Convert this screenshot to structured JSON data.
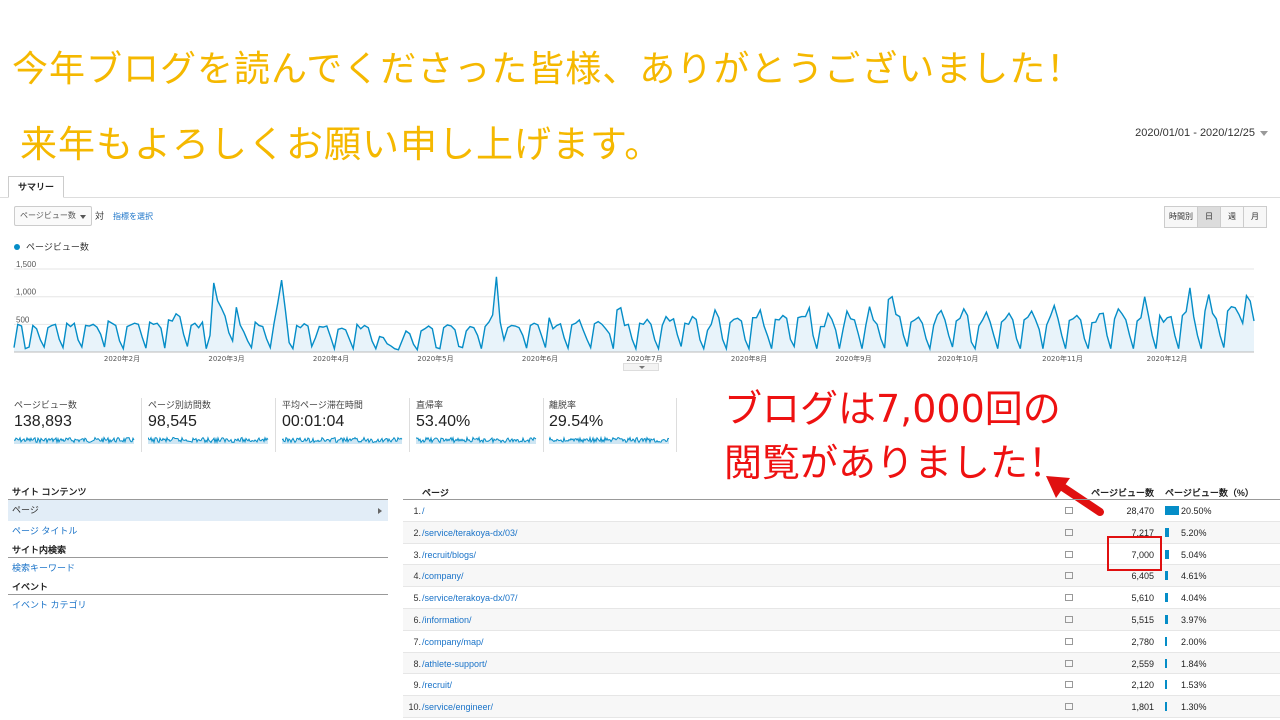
{
  "headline": {
    "line1": "今年ブログを読んでくださった皆様、ありがとうございました！",
    "line2": "来年もよろしくお願い申し上げます。"
  },
  "date_range": "2020/01/01 - 2020/12/25",
  "tabs": [
    "サマリー"
  ],
  "controls": {
    "metric_select": "ページビュー数",
    "vs_label": "対",
    "select_metric_link": "指標を選択",
    "granularity": [
      "時間別",
      "日",
      "週",
      "月"
    ],
    "granularity_selected": "日"
  },
  "chart_data": {
    "type": "line",
    "series": [
      {
        "name": "ページビュー数"
      }
    ],
    "yticks": [
      "1,500",
      "1,000",
      "500"
    ],
    "ylim": [
      0,
      1700
    ],
    "xticks": [
      "2020年2月",
      "2020年3月",
      "2020年4月",
      "2020年5月",
      "2020年6月",
      "2020年7月",
      "2020年8月",
      "2020年9月",
      "2020年10月",
      "2020年11月",
      "2020年12月"
    ],
    "values": [
      80,
      500,
      470,
      60,
      90,
      480,
      420,
      220,
      90,
      440,
      480,
      500,
      230,
      80,
      520,
      460,
      520,
      220,
      90,
      480,
      470,
      500,
      450,
      320,
      90,
      560,
      520,
      480,
      200,
      60,
      460,
      490,
      520,
      500,
      270,
      70,
      540,
      500,
      520,
      430,
      70,
      580,
      560,
      690,
      640,
      320,
      100,
      480,
      520,
      440,
      540,
      60,
      300,
      1250,
      930,
      800,
      650,
      350,
      200,
      810,
      490,
      360,
      200,
      80,
      540,
      480,
      460,
      240,
      80,
      520,
      890,
      1300,
      760,
      170,
      60,
      480,
      440,
      510,
      470,
      100,
      260,
      460,
      450,
      470,
      270,
      60,
      410,
      430,
      400,
      230,
      60,
      500,
      420,
      480,
      440,
      200,
      60,
      280,
      260,
      150,
      110,
      60,
      40,
      210,
      380,
      330,
      140,
      40,
      380,
      420,
      470,
      420,
      80,
      60,
      440,
      490,
      470,
      400,
      100,
      80,
      380,
      460,
      440,
      300,
      60,
      460,
      540,
      670,
      1360,
      540,
      220,
      440,
      480,
      470,
      440,
      300,
      70,
      480,
      520,
      490,
      290,
      80,
      620,
      420,
      480,
      510,
      250,
      70,
      490,
      520,
      580,
      400,
      230,
      80,
      510,
      550,
      500,
      420,
      330,
      60,
      760,
      800,
      480,
      500,
      230,
      60,
      520,
      500,
      590,
      500,
      220,
      60,
      480,
      640,
      560,
      600,
      310,
      100,
      520,
      500,
      640,
      590,
      220,
      60,
      390,
      500,
      760,
      620,
      230,
      60,
      530,
      590,
      610,
      560,
      220,
      60,
      620,
      620,
      760,
      470,
      280,
      60,
      590,
      580,
      660,
      610,
      230,
      100,
      620,
      640,
      640,
      800,
      300,
      60,
      460,
      460,
      700,
      590,
      400,
      60,
      420,
      740,
      600,
      580,
      330,
      60,
      480,
      820,
      580,
      500,
      240,
      70,
      950,
      1000,
      680,
      640,
      300,
      100,
      540,
      580,
      630,
      520,
      240,
      60,
      480,
      670,
      750,
      580,
      300,
      90,
      560,
      610,
      780,
      660,
      180,
      60,
      470,
      580,
      720,
      540,
      290,
      60,
      540,
      600,
      700,
      580,
      240,
      60,
      580,
      630,
      740,
      590,
      410,
      60,
      490,
      650,
      840,
      600,
      300,
      60,
      570,
      600,
      660,
      580,
      240,
      60,
      530,
      540,
      690,
      700,
      300,
      60,
      600,
      780,
      690,
      580,
      300,
      60,
      560,
      620,
      1000,
      660,
      300,
      60,
      660,
      540,
      620,
      640,
      300,
      60,
      660,
      730,
      1160,
      640,
      300,
      60,
      740,
      1040,
      700,
      600,
      300,
      80,
      740,
      820,
      800,
      680,
      520,
      1020,
      920,
      560
    ]
  },
  "scorecards": [
    {
      "label": "ページビュー数",
      "value": "138,893"
    },
    {
      "label": "ページ別訪問数",
      "value": "98,545"
    },
    {
      "label": "平均ページ滞在時間",
      "value": "00:01:04"
    },
    {
      "label": "直帰率",
      "value": "53.40%"
    },
    {
      "label": "離脱率",
      "value": "29.54%"
    }
  ],
  "annotation": {
    "line1": "ブログは7,000回の",
    "line2": "閲覧がありました！",
    "color": "#ee1111"
  },
  "sidebar": {
    "sections": [
      {
        "title": "サイト コンテンツ",
        "items": [
          "ページ",
          "ページ タイトル"
        ],
        "selected": "ページ"
      },
      {
        "title": "サイト内検索",
        "items": [
          "検索キーワード"
        ]
      },
      {
        "title": "イベント",
        "items": [
          "イベント カテゴリ"
        ]
      }
    ]
  },
  "table": {
    "headers": {
      "page": "ページ",
      "pageviews": "ページビュー数",
      "pct": "ページビュー数（%）"
    },
    "rows": [
      {
        "rank": "1.",
        "page": "/",
        "pageviews": "28,470",
        "pct": "20.50%",
        "share": 0.205
      },
      {
        "rank": "2.",
        "page": "/service/terakoya-dx/03/",
        "pageviews": "7,217",
        "pct": "5.20%",
        "share": 0.052
      },
      {
        "rank": "3.",
        "page": "/recruit/blogs/",
        "pageviews": "7,000",
        "pct": "5.04%",
        "share": 0.0504
      },
      {
        "rank": "4.",
        "page": "/company/",
        "pageviews": "6,405",
        "pct": "4.61%",
        "share": 0.0461
      },
      {
        "rank": "5.",
        "page": "/service/terakoya-dx/07/",
        "pageviews": "5,610",
        "pct": "4.04%",
        "share": 0.0404
      },
      {
        "rank": "6.",
        "page": "/information/",
        "pageviews": "5,515",
        "pct": "3.97%",
        "share": 0.0397
      },
      {
        "rank": "7.",
        "page": "/company/map/",
        "pageviews": "2,780",
        "pct": "2.00%",
        "share": 0.02
      },
      {
        "rank": "8.",
        "page": "/athlete-support/",
        "pageviews": "2,559",
        "pct": "1.84%",
        "share": 0.0184
      },
      {
        "rank": "9.",
        "page": "/recruit/",
        "pageviews": "2,120",
        "pct": "1.53%",
        "share": 0.0153
      },
      {
        "rank": "10.",
        "page": "/service/engineer/",
        "pageviews": "1,801",
        "pct": "1.30%",
        "share": 0.013
      }
    ]
  },
  "colors": {
    "headline": "#f5b800",
    "line": "#058dc7",
    "area": "#e8f3fa",
    "highlight": "#e01010"
  }
}
